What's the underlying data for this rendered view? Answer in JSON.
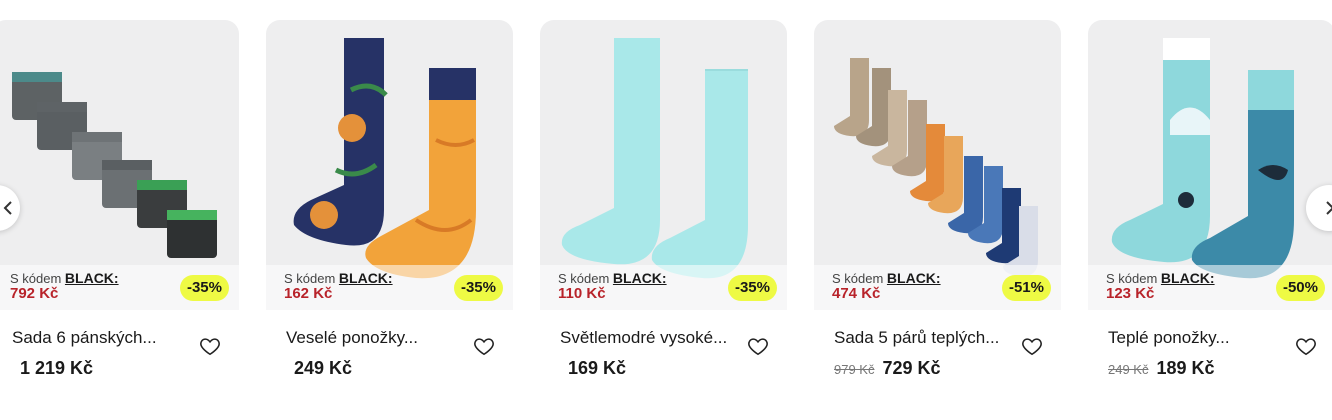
{
  "products": [
    {
      "promo_prefix": "S kódem ",
      "promo_code": "BLACK:",
      "promo_price": "792 Kč",
      "discount": "-35%",
      "name": "Sada 6 pánských...",
      "old_price": "",
      "price": "1 219 Kč",
      "image_icon": "boxer-briefs-set-image"
    },
    {
      "promo_prefix": "S kódem ",
      "promo_code": "BLACK:",
      "promo_price": "162 Kč",
      "discount": "-35%",
      "name": "Veselé ponožky...",
      "old_price": "",
      "price": "249 Kč",
      "image_icon": "fox-socks-image"
    },
    {
      "promo_prefix": "S kódem ",
      "promo_code": "BLACK:",
      "promo_price": "110 Kč",
      "discount": "-35%",
      "name": "Světlemodré vysoké...",
      "old_price": "",
      "price": "169 Kč",
      "image_icon": "light-blue-socks-image"
    },
    {
      "promo_prefix": "S kódem ",
      "promo_code": "BLACK:",
      "promo_price": "474 Kč",
      "discount": "-51%",
      "name": "Sada 5 párů teplých...",
      "old_price": "979 Kč",
      "price": "729 Kč",
      "image_icon": "warm-socks-set-image"
    },
    {
      "promo_prefix": "S kódem ",
      "promo_code": "BLACK:",
      "promo_price": "123 Kč",
      "discount": "-50%",
      "name": "Teplé ponožky...",
      "old_price": "249 Kč",
      "price": "189 Kč",
      "image_icon": "arctic-socks-image"
    }
  ],
  "icons": {
    "favorite": "heart-outline-icon",
    "prev": "chevron-left-icon",
    "next": "chevron-right-icon"
  },
  "colors": {
    "promo_price": "#b8232a",
    "badge_bg": "#eefa44",
    "card_image_bg": "#eeeeef"
  }
}
